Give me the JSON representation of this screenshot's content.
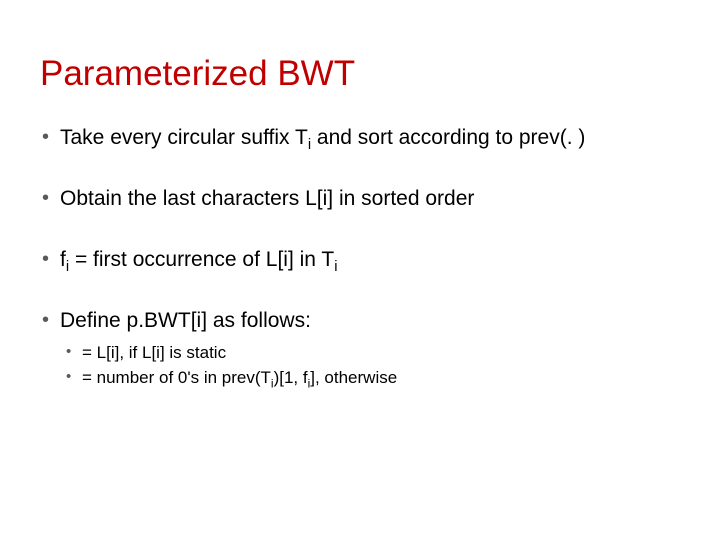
{
  "title": "Parameterized BWT",
  "bullets": {
    "b1": {
      "pre": "Take every circular suffix T",
      "sub1": "i",
      "post": " and sort according to prev(. )"
    },
    "b2": {
      "text": "Obtain the last characters L[i] in sorted order"
    },
    "b3": {
      "pre": "f",
      "sub1": "i",
      "mid": " = first occurrence of L[i] in T",
      "sub2": "i"
    },
    "b4": {
      "text": "Define p.BWT[i] as follows:",
      "sub": {
        "s1": {
          "text": "= L[i], if L[i] is static"
        },
        "s2": {
          "pre": "= number of 0's in prev(T",
          "sub1": "i",
          "mid": ")[1, f",
          "sub2": "i",
          "post": "], otherwise"
        }
      }
    }
  }
}
